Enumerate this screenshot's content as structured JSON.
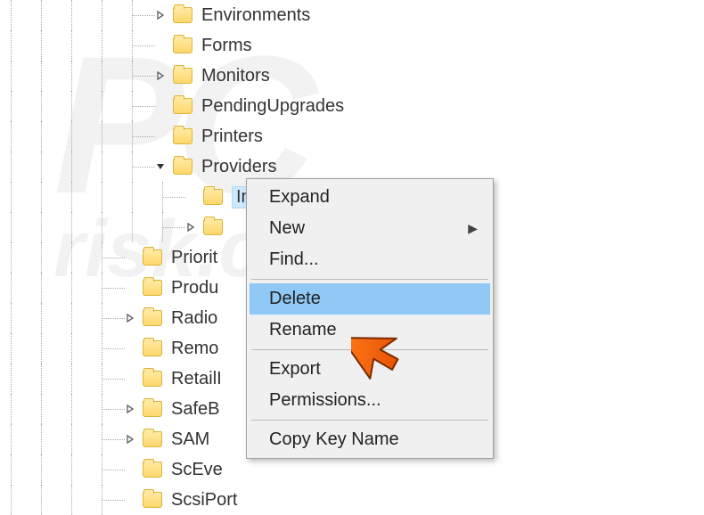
{
  "tree": {
    "items": [
      {
        "indent": 5,
        "expander": "right",
        "label": "Environments"
      },
      {
        "indent": 5,
        "expander": "",
        "label": "Forms"
      },
      {
        "indent": 5,
        "expander": "right",
        "label": "Monitors"
      },
      {
        "indent": 5,
        "expander": "",
        "label": "PendingUpgrades"
      },
      {
        "indent": 5,
        "expander": "",
        "label": "Printers"
      },
      {
        "indent": 5,
        "expander": "down",
        "label": "Providers"
      },
      {
        "indent": 6,
        "expander": "",
        "label": "Internet Print Provider",
        "selected": true
      },
      {
        "indent": 6,
        "expander": "right",
        "label": ""
      },
      {
        "indent": 4,
        "expander": "",
        "label": "Priorit"
      },
      {
        "indent": 4,
        "expander": "",
        "label": "Produ"
      },
      {
        "indent": 4,
        "expander": "right",
        "label": "Radio"
      },
      {
        "indent": 4,
        "expander": "",
        "label": "Remo"
      },
      {
        "indent": 4,
        "expander": "",
        "label": "RetailI"
      },
      {
        "indent": 4,
        "expander": "right",
        "label": "SafeB"
      },
      {
        "indent": 4,
        "expander": "right",
        "label": "SAM"
      },
      {
        "indent": 4,
        "expander": "",
        "label": "ScEve"
      },
      {
        "indent": 4,
        "expander": "",
        "label": "ScsiPort"
      }
    ]
  },
  "menu": {
    "items": [
      {
        "label": "Expand"
      },
      {
        "label": "New",
        "submenu": true
      },
      {
        "label": "Find..."
      },
      {
        "sep": true
      },
      {
        "label": "Delete",
        "hover": true
      },
      {
        "label": "Rename"
      },
      {
        "sep": true
      },
      {
        "label": "Export"
      },
      {
        "label": "Permissions..."
      },
      {
        "sep": true
      },
      {
        "label": "Copy Key Name"
      }
    ]
  },
  "watermark": {
    "main": "PC",
    "sub": "risk.com"
  }
}
